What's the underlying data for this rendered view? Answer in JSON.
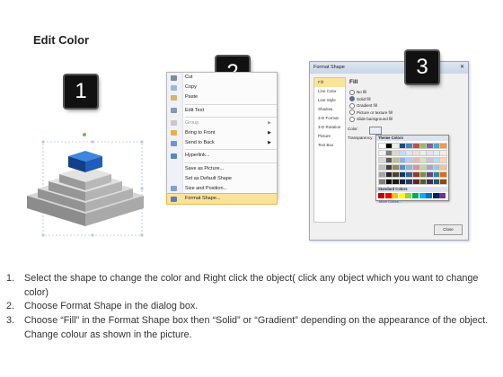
{
  "title": "Edit Color",
  "badges": [
    "1",
    "2",
    "3"
  ],
  "colors": {
    "pyramid_top": "#1e5eb8",
    "pyramid_step": "#9b9b9b",
    "highlight": "#fbe39a"
  },
  "context_menu": {
    "items": [
      {
        "label": "Cut",
        "icon": "scissors-icon",
        "disabled": false,
        "submenu": false
      },
      {
        "label": "Copy",
        "icon": "copy-icon",
        "disabled": false,
        "submenu": false
      },
      {
        "label": "Paste",
        "icon": "paste-icon",
        "disabled": false,
        "submenu": false
      },
      {
        "label": "Edit Text",
        "icon": "edit-text-icon",
        "disabled": false,
        "submenu": false
      },
      {
        "label": "Group",
        "icon": "group-icon",
        "disabled": true,
        "submenu": true
      },
      {
        "label": "Bring to Front",
        "icon": "bring-front-icon",
        "disabled": false,
        "submenu": true
      },
      {
        "label": "Send to Back",
        "icon": "send-back-icon",
        "disabled": false,
        "submenu": true
      },
      {
        "label": "Hyperlink...",
        "icon": "hyperlink-icon",
        "disabled": false,
        "submenu": false
      },
      {
        "label": "Save as Picture...",
        "icon": "",
        "disabled": false,
        "submenu": false
      },
      {
        "label": "Set as Default Shape",
        "icon": "",
        "disabled": false,
        "submenu": false
      },
      {
        "label": "Size and Position...",
        "icon": "size-icon",
        "disabled": false,
        "submenu": false
      },
      {
        "label": "Format Shape...",
        "icon": "format-shape-icon",
        "disabled": false,
        "submenu": false,
        "highlighted": true
      }
    ]
  },
  "format_dialog": {
    "title": "Format Shape",
    "close": "✕",
    "nav": [
      "Fill",
      "Line Color",
      "Line Style",
      "Shadow",
      "3-D Format",
      "3-D Rotation",
      "Picture",
      "Text Box"
    ],
    "fill_heading": "Fill",
    "options": [
      "No fill",
      "Solid fill",
      "Gradient fill",
      "Picture or texture fill",
      "Slide background fill"
    ],
    "color_label": "Color:",
    "transparency_label": "Transparency:",
    "theme_colors": "Theme Colors",
    "standard_colors": "Standard Colors",
    "more_colors": "More Colors...",
    "close_button": "Close",
    "theme_palette": [
      [
        "#ffffff",
        "#000000",
        "#eeece1",
        "#1f497d",
        "#4f81bd",
        "#c0504d",
        "#9bbb59",
        "#8064a2",
        "#4bacc6",
        "#f79646"
      ],
      [
        "#f2f2f2",
        "#7f7f7f",
        "#ddd9c3",
        "#c6d9f0",
        "#dbe5f1",
        "#f2dcdb",
        "#ebf1dd",
        "#e5e0ec",
        "#dbeef3",
        "#fdeada"
      ],
      [
        "#d8d8d8",
        "#595959",
        "#c4bd97",
        "#8db3e2",
        "#b8cce4",
        "#e5b9b7",
        "#d7e3bc",
        "#ccc1d9",
        "#b7dde8",
        "#fbd5b5"
      ],
      [
        "#bfbfbf",
        "#3f3f3f",
        "#938953",
        "#548dd4",
        "#95b3d7",
        "#d99694",
        "#c3d69b",
        "#b2a2c7",
        "#92cddc",
        "#fac08f"
      ],
      [
        "#a5a5a5",
        "#262626",
        "#494429",
        "#17365d",
        "#366092",
        "#953734",
        "#76923c",
        "#5f497a",
        "#31859b",
        "#e36c09"
      ],
      [
        "#7f7f7f",
        "#0c0c0c",
        "#1d1b10",
        "#0f243e",
        "#244061",
        "#632423",
        "#4f6128",
        "#3f3151",
        "#205867",
        "#974806"
      ]
    ],
    "standard_palette": [
      "#c00000",
      "#ff0000",
      "#ffc000",
      "#ffff00",
      "#92d050",
      "#00b050",
      "#00b0f0",
      "#0070c0",
      "#002060",
      "#7030a0"
    ]
  },
  "steps": [
    {
      "num": "1.",
      "text": "Select the shape to change the color and Right click the object( click any object which you want to change color)"
    },
    {
      "num": "2.",
      "text": "Choose Format Shape in the dialog box."
    },
    {
      "num": "3.",
      "text": "Choose “Fill” in the Format Shape box then “Solid” or “Gradient” depending on the appearance of the object. Change colour as shown in the picture."
    }
  ]
}
